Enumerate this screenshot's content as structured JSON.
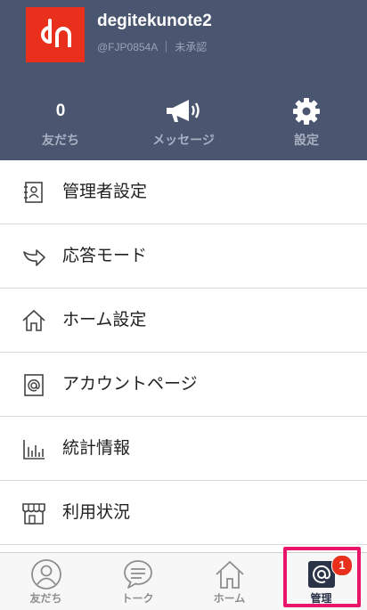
{
  "account": {
    "name": "degitekunote2",
    "id": "@FJP0854A",
    "status": "未承認",
    "logo_icon": "dn-logo",
    "logo_color": "#e8301c"
  },
  "stats": [
    {
      "value": "0",
      "label": "友だち"
    },
    {
      "icon": "megaphone-icon",
      "label": "メッセージ"
    },
    {
      "icon": "gear-icon",
      "label": "設定"
    }
  ],
  "menu": {
    "items": [
      {
        "label": "管理者設定",
        "icon": "admin-book-icon"
      },
      {
        "label": "応答モード",
        "icon": "reply-arrow-icon"
      },
      {
        "label": "ホーム設定",
        "icon": "home-icon"
      },
      {
        "label": "アカウントページ",
        "icon": "at-page-icon"
      },
      {
        "label": "統計情報",
        "icon": "bar-chart-icon"
      },
      {
        "label": "利用状況",
        "icon": "store-icon"
      }
    ]
  },
  "tabbar": {
    "tabs": [
      {
        "label": "友だち",
        "icon": "person-icon"
      },
      {
        "label": "トーク",
        "icon": "chat-bubble-icon"
      },
      {
        "label": "ホーム",
        "icon": "home-icon"
      },
      {
        "label": "管理",
        "icon": "at-square-icon",
        "active": true
      }
    ],
    "badge": "1"
  },
  "colors": {
    "header_bg": "#4a5670",
    "highlight": "#e8156b",
    "badge": "#e8301c"
  }
}
